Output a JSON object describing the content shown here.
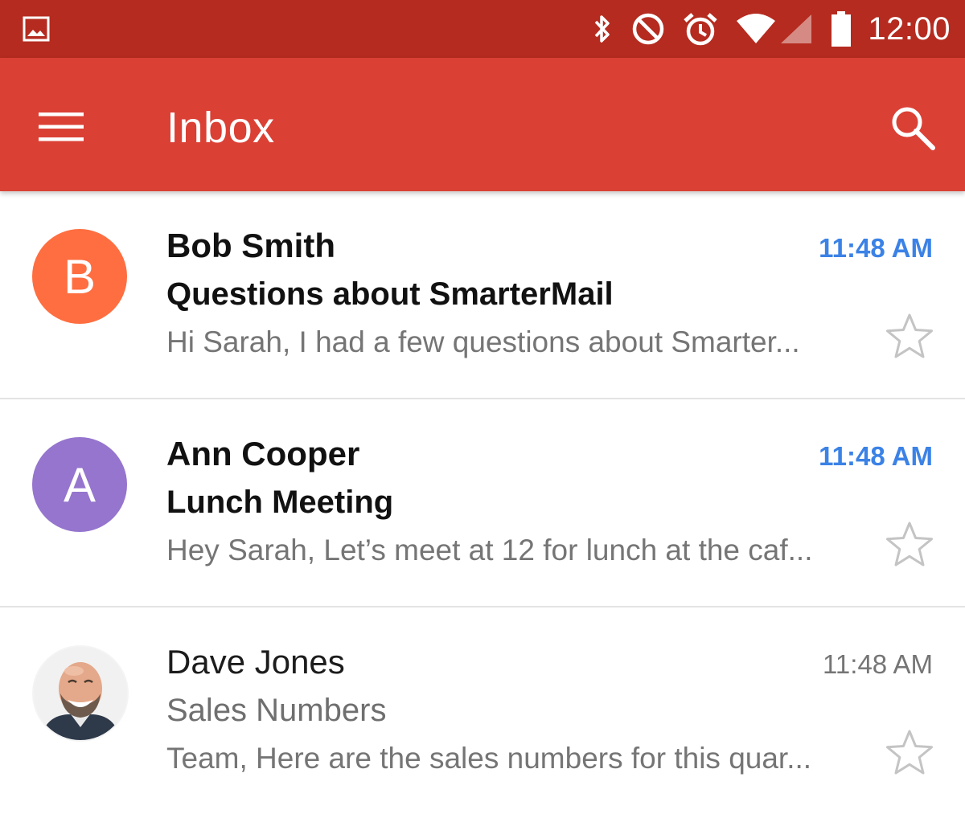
{
  "status_bar": {
    "time": "12:00",
    "icons": [
      "image-icon",
      "bluetooth-icon",
      "do-not-disturb-icon",
      "alarm-icon",
      "wifi-icon",
      "cell-signal-icon",
      "battery-icon"
    ],
    "background": "#b52b1f"
  },
  "app_bar": {
    "title": "Inbox",
    "background": "#db4035",
    "menu_icon": "menu-icon",
    "search_icon": "search-icon"
  },
  "messages": [
    {
      "avatar_letter": "B",
      "avatar_color": "#ff6e40",
      "sender": "Bob Smith",
      "subject": "Questions about SmarterMail",
      "preview": "Hi Sarah, I had a few questions about Smarter...",
      "time": "11:48 AM",
      "unread": true,
      "starred": false
    },
    {
      "avatar_letter": "A",
      "avatar_color": "#9575cd",
      "sender": "Ann Cooper",
      "subject": "Lunch Meeting",
      "preview": "Hey Sarah, Let’s meet at 12 for lunch at the caf...",
      "time": "11:48 AM",
      "unread": true,
      "starred": false
    },
    {
      "avatar_letter": "",
      "avatar_icon": "profile-photo",
      "sender": "Dave Jones",
      "subject": "Sales Numbers",
      "preview": "Team, Here are the sales numbers for this quar...",
      "time": "11:48 AM",
      "unread": false,
      "starred": false
    }
  ],
  "colors": {
    "unread_time": "#3b82e6",
    "read_time": "#757575",
    "preview_text": "#757575",
    "divider": "#e3e3e3"
  }
}
